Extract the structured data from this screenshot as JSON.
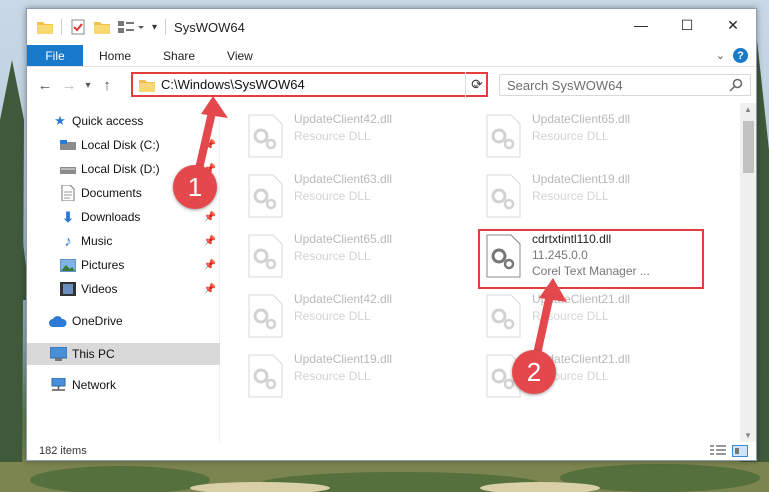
{
  "window": {
    "title": "SysWOW64"
  },
  "controls": {
    "minimize": "—",
    "maximize": "☐",
    "close": "✕"
  },
  "ribbon": {
    "file": "File",
    "tabs": [
      "Home",
      "Share",
      "View"
    ]
  },
  "address": {
    "path": "C:\\Windows\\SysWOW64"
  },
  "search": {
    "placeholder": "Search SysWOW64"
  },
  "sidebar": {
    "quick_access": "Quick access",
    "items": [
      {
        "label": "Local Disk (C:)",
        "pinned": true
      },
      {
        "label": "Local Disk (D:)",
        "pinned": true
      },
      {
        "label": "Documents",
        "pinned": true
      },
      {
        "label": "Downloads",
        "pinned": true
      },
      {
        "label": "Music",
        "pinned": true
      },
      {
        "label": "Pictures",
        "pinned": true
      },
      {
        "label": "Videos",
        "pinned": true
      }
    ],
    "onedrive": "OneDrive",
    "thispc": "This PC",
    "network": "Network"
  },
  "files": [
    {
      "name": "UpdateClient42.dll",
      "desc": "Resource DLL"
    },
    {
      "name": "UpdateClient65.dll",
      "desc": "Resource DLL"
    },
    {
      "name": "UpdateClient63.dll",
      "desc": "Resource DLL"
    },
    {
      "name": "UpdateClient19.dll",
      "desc": "Resource DLL"
    },
    {
      "name": "UpdateClient65.dll",
      "desc": "Resource DLL"
    },
    {
      "name": "cdrtxtintl110.dll",
      "version": "11.245.0.0",
      "desc": "Corel Text Manager ..."
    },
    {
      "name": "UpdateClient42.dll",
      "desc": "Resource DLL"
    },
    {
      "name": "UpdateClient21.dll",
      "desc": "Resource DLL"
    },
    {
      "name": "UpdateClient19.dll",
      "desc": "Resource DLL"
    },
    {
      "name": "UpdateClient21.dll",
      "desc": "Resource DLL"
    }
  ],
  "status": {
    "count": "182 items"
  },
  "callouts": {
    "one": "1",
    "two": "2"
  },
  "colors": {
    "accent": "#1979ca",
    "highlight": "#e43d3d"
  }
}
